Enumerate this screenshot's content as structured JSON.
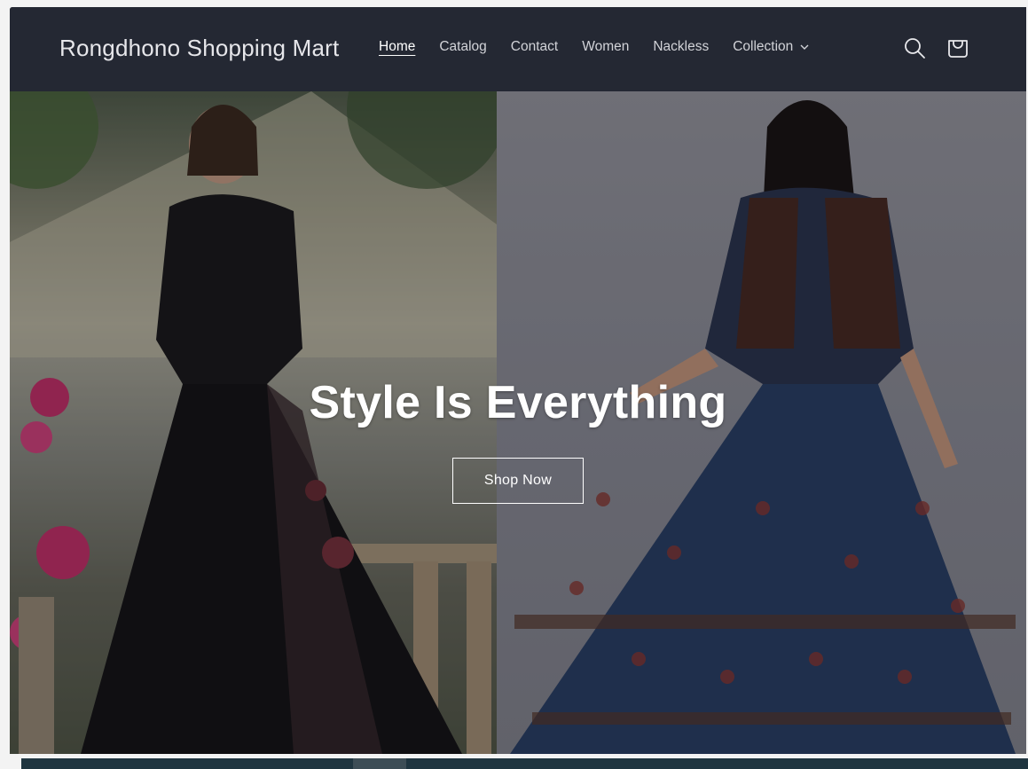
{
  "header": {
    "brand": "Rongdhono Shopping Mart",
    "nav": [
      {
        "label": "Home",
        "active": true
      },
      {
        "label": "Catalog"
      },
      {
        "label": "Contact"
      },
      {
        "label": "Women"
      },
      {
        "label": "Nackless"
      },
      {
        "label": "Collection",
        "dropdown": true
      }
    ],
    "icons": [
      "search-icon",
      "cart-icon"
    ]
  },
  "hero": {
    "title": "Style Is Everything",
    "button_label": "Shop Now",
    "left_image": "woman-in-black-floral-gown",
    "right_image": "woman-in-blue-printed-gown-with-jacket"
  },
  "colors": {
    "header_bg": "#242833",
    "text_light": "#ffffff",
    "nav_text": "#d2d3d8"
  }
}
